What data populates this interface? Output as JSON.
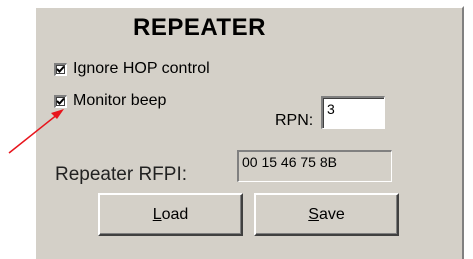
{
  "panel": {
    "title": "REPEATER"
  },
  "checkboxes": [
    {
      "label": "Ignore HOP control",
      "checked": true
    },
    {
      "label": "Monitor beep",
      "checked": true
    }
  ],
  "rpn": {
    "label": "RPN:",
    "value": "3"
  },
  "rfpi": {
    "label": "Repeater RFPI:",
    "value": "00 15 46 75 8B"
  },
  "buttons": {
    "load": {
      "accel": "L",
      "rest": "oad"
    },
    "save": {
      "accel": "S",
      "rest": "ave"
    }
  },
  "annotation": {
    "arrow_color": "#e8141c"
  }
}
